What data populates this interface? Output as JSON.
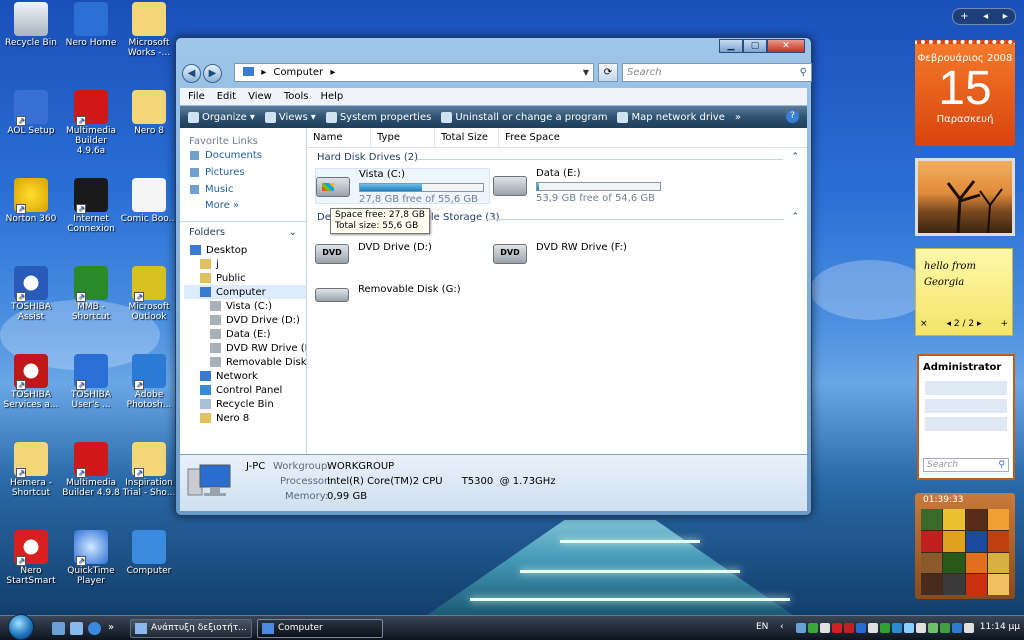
{
  "desktop": {
    "icons": [
      {
        "label": "Recycle Bin"
      },
      {
        "label": "Nero Home"
      },
      {
        "label": "Microsoft Works -..."
      },
      {
        "label": "AOL Setup"
      },
      {
        "label": "Multimedia Builder 4.9.6a"
      },
      {
        "label": "Nero 8"
      },
      {
        "label": "Norton 360"
      },
      {
        "label": "Internet Connexion"
      },
      {
        "label": "Comic Boo..."
      },
      {
        "label": "TOSHIBA Assist"
      },
      {
        "label": "MMB - Shortcut"
      },
      {
        "label": "Microsoft Outlook"
      },
      {
        "label": "TOSHIBA Services a..."
      },
      {
        "label": "TOSHIBA User's ..."
      },
      {
        "label": "Adobe Photosh..."
      },
      {
        "label": "Hemera - Shortcut"
      },
      {
        "label": "Multimedia Builder 4.9.8"
      },
      {
        "label": "Inspiration Trial - Sho..."
      },
      {
        "label": "Nero StartSmart"
      },
      {
        "label": "QuickTime Player"
      },
      {
        "label": "Computer"
      }
    ]
  },
  "window": {
    "address": "Computer",
    "search_placeholder": "Search",
    "menu": [
      "File",
      "Edit",
      "View",
      "Tools",
      "Help"
    ],
    "toolbar": [
      "Organize",
      "Views",
      "System properties",
      "Uninstall or change a program",
      "Map network drive"
    ],
    "toolbar_overflow": "»",
    "favorites_title": "Favorite Links",
    "favorites": [
      "Documents",
      "Pictures",
      "Music"
    ],
    "more": "More",
    "folders_title": "Folders",
    "tree": [
      "Desktop",
      "j",
      "Public",
      "Computer",
      "Vista (C:)",
      "DVD Drive (D:)",
      "Data (E:)",
      "DVD RW Drive (F:)",
      "Removable Disk (G:)",
      "Network",
      "Control Panel",
      "Recycle Bin",
      "Nero 8"
    ],
    "columns": [
      "Name",
      "Type",
      "Total Size",
      "Free Space"
    ],
    "groups": {
      "hdd": "Hard Disk Drives (2)",
      "removable": "Devices with Removable Storage (3)"
    },
    "drives": [
      {
        "name": "Vista (C:)",
        "free": "27,8 GB free of 55,6 GB",
        "used_fraction": 0.5
      },
      {
        "name": "Data (E:)",
        "free": "53,9 GB free of 54,6 GB",
        "used_fraction": 0.013
      }
    ],
    "removable": [
      {
        "name": "DVD Drive (D:)"
      },
      {
        "name": "DVD RW Drive (F:)"
      },
      {
        "name": "Removable Disk (G:)"
      }
    ],
    "tooltip": {
      "line1": "Space free: 27,8 GB",
      "line2": "Total size: 55,6 GB"
    },
    "details": {
      "computer_name": "J-PC",
      "workgroup_label": "Workgroup:",
      "workgroup": "WORKGROUP",
      "processor_label": "Processor:",
      "processor": "Intel(R) Core(TM)2 CPU      T5300  @ 1.73GHz",
      "memory_label": "Memory:",
      "memory": "0,99 GB"
    }
  },
  "sidebar": {
    "calendar": {
      "month_year": "Φεβρουάριος 2008",
      "day": "15",
      "weekday": "Παρασκευή"
    },
    "note": {
      "text": "hello from Georgia",
      "page": "2 / 2",
      "prev": "◂",
      "next": "▸",
      "close": "×",
      "add": "+"
    },
    "contacts": {
      "title": "Administrator",
      "search": "Search"
    },
    "puzzle": {
      "time": "01:39:33"
    }
  },
  "taskbar": {
    "buttons": [
      "Ανάπτυξη δεξιοτήτ...",
      "Computer"
    ],
    "language": "EN",
    "time": "11:14 μμ"
  },
  "colors": {
    "accent": "#1d5fa8",
    "toolbar": "#2f5370",
    "calendar": "#e8541a"
  }
}
